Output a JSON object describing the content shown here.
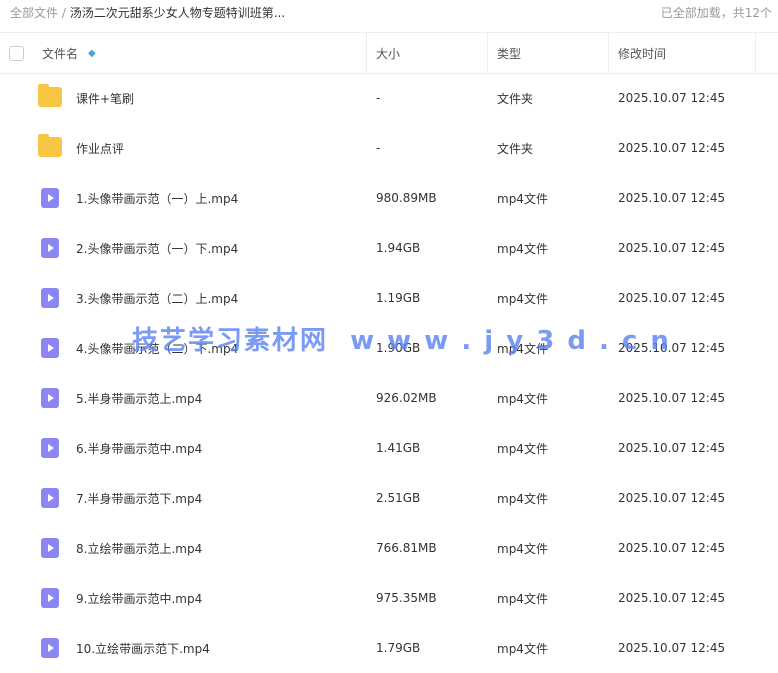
{
  "breadcrumb": {
    "root": "全部文件",
    "sep": " / ",
    "current": "汤汤二次元甜系少女人物专题特训班第..."
  },
  "status": "已全部加载，共12个",
  "columns": {
    "name": "文件名",
    "size": "大小",
    "type": "类型",
    "modified": "修改时间"
  },
  "sort_icon": "sort-ascending-icon",
  "files": [
    {
      "icon": "folder",
      "name": "课件+笔刷",
      "size": "-",
      "type": "文件夹",
      "modified": "2025.10.07 12:45"
    },
    {
      "icon": "folder",
      "name": "作业点评",
      "size": "-",
      "type": "文件夹",
      "modified": "2025.10.07 12:45"
    },
    {
      "icon": "video",
      "name": "1.头像带画示范（一）上.mp4",
      "size": "980.89MB",
      "type": "mp4文件",
      "modified": "2025.10.07 12:45"
    },
    {
      "icon": "video",
      "name": "2.头像带画示范（一）下.mp4",
      "size": "1.94GB",
      "type": "mp4文件",
      "modified": "2025.10.07 12:45"
    },
    {
      "icon": "video",
      "name": "3.头像带画示范（二）上.mp4",
      "size": "1.19GB",
      "type": "mp4文件",
      "modified": "2025.10.07 12:45"
    },
    {
      "icon": "video",
      "name": "4.头像带画示范（二）下.mp4",
      "size": "1.90GB",
      "type": "mp4文件",
      "modified": "2025.10.07 12:45"
    },
    {
      "icon": "video",
      "name": "5.半身带画示范上.mp4",
      "size": "926.02MB",
      "type": "mp4文件",
      "modified": "2025.10.07 12:45"
    },
    {
      "icon": "video",
      "name": "6.半身带画示范中.mp4",
      "size": "1.41GB",
      "type": "mp4文件",
      "modified": "2025.10.07 12:45"
    },
    {
      "icon": "video",
      "name": "7.半身带画示范下.mp4",
      "size": "2.51GB",
      "type": "mp4文件",
      "modified": "2025.10.07 12:45"
    },
    {
      "icon": "video",
      "name": "8.立绘带画示范上.mp4",
      "size": "766.81MB",
      "type": "mp4文件",
      "modified": "2025.10.07 12:45"
    },
    {
      "icon": "video",
      "name": "9.立绘带画示范中.mp4",
      "size": "975.35MB",
      "type": "mp4文件",
      "modified": "2025.10.07 12:45"
    },
    {
      "icon": "video",
      "name": "10.立绘带画示范下.mp4",
      "size": "1.79GB",
      "type": "mp4文件",
      "modified": "2025.10.07 12:45"
    }
  ],
  "watermark": "技艺学习素材网  w w w . j y 3 d . c n"
}
